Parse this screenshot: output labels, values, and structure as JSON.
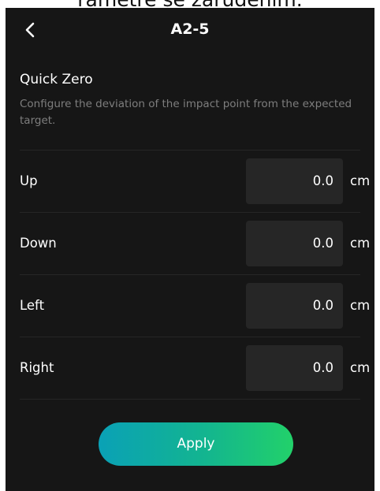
{
  "caption": "rametre se zarudením.",
  "nav": {
    "title": "A2-5"
  },
  "icons": {
    "back": "chevron-left-icon"
  },
  "section": {
    "title": "Quick Zero",
    "description": "Configure the deviation of the impact point from the expected target."
  },
  "rows": [
    {
      "label": "Up",
      "value": "0.0",
      "unit": "cm"
    },
    {
      "label": "Down",
      "value": "0.0",
      "unit": "cm"
    },
    {
      "label": "Left",
      "value": "0.0",
      "unit": "cm"
    },
    {
      "label": "Right",
      "value": "0.0",
      "unit": "cm"
    }
  ],
  "apply_label": "Apply",
  "colors": {
    "screen_background": "#161616",
    "field_background": "#262626",
    "description_text": "#7e7e7e",
    "button_gradient_start": "#0aa1b6",
    "button_gradient_end": "#22d16a"
  }
}
